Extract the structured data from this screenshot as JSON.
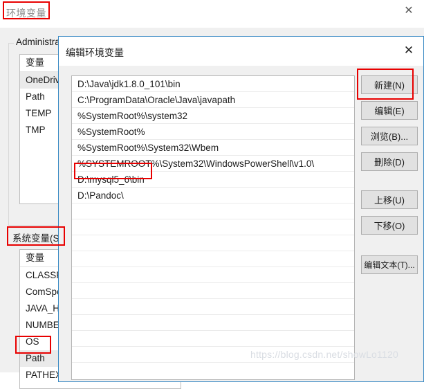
{
  "base_window": {
    "title": "环境变量",
    "close_icon": "close-icon",
    "user_group_label": "Administrat",
    "user_variables": {
      "header": "变量",
      "rows": [
        {
          "name": "OneDrive",
          "selected": true
        },
        {
          "name": "Path",
          "selected": false
        },
        {
          "name": "TEMP",
          "selected": false
        },
        {
          "name": "TMP",
          "selected": false
        }
      ]
    },
    "system_section_label": "系统变量(S)",
    "system_variables": {
      "header": "变量",
      "rows": [
        {
          "name": "CLASSPAT",
          "selected": false
        },
        {
          "name": "ComSpec",
          "selected": false
        },
        {
          "name": "JAVA_HOI",
          "selected": false
        },
        {
          "name": "NUMBER_",
          "selected": false
        },
        {
          "name": "OS",
          "selected": false
        },
        {
          "name": "Path",
          "selected": true
        },
        {
          "name": "PATHEXT",
          "selected": false
        }
      ]
    }
  },
  "edit_dialog": {
    "title": "编辑环境变量",
    "close_icon": "close-icon",
    "path_entries": [
      "D:\\Java\\jdk1.8.0_101\\bin",
      "C:\\ProgramData\\Oracle\\Java\\javapath",
      "%SystemRoot%\\system32",
      "%SystemRoot%",
      "%SystemRoot%\\System32\\Wbem",
      "%SYSTEMROOT%\\System32\\WindowsPowerShell\\v1.0\\",
      "D:\\mysql5_6\\bin",
      "D:\\Pandoc\\"
    ],
    "empty_row_count": 10,
    "buttons": [
      {
        "label": "新建(N)",
        "group": 0
      },
      {
        "label": "编辑(E)",
        "group": 0
      },
      {
        "label": "浏览(B)...",
        "group": 0
      },
      {
        "label": "删除(D)",
        "group": 0
      },
      {
        "label": "上移(U)",
        "group": 1
      },
      {
        "label": "下移(O)",
        "group": 1
      },
      {
        "label": "编辑文本(T)...",
        "group": 2
      }
    ]
  },
  "annotations": {
    "accent_color": "#e80000",
    "highlighted": [
      "环境变量",
      "系统变量(S)",
      "Path",
      "新建(N)",
      "D:\\mysql5_6\\bin"
    ]
  },
  "watermark": {
    "text": "https://blog.csdn.net/showLo1120"
  }
}
